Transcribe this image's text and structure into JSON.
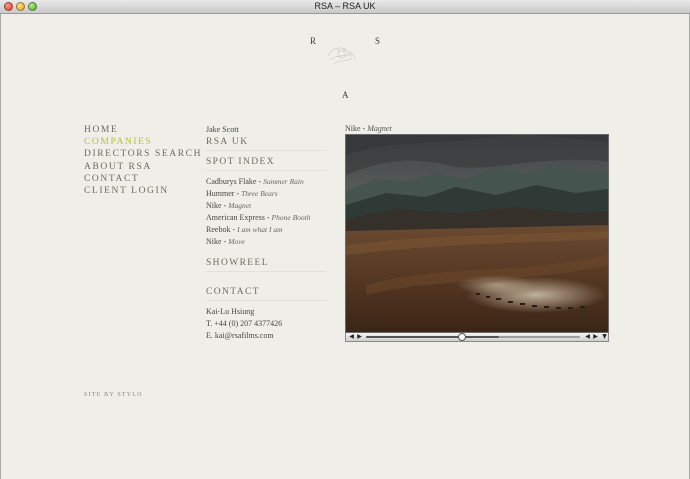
{
  "window": {
    "title": "RSA – RSA UK"
  },
  "logo": {
    "letters": [
      "R",
      "S",
      "A"
    ]
  },
  "nav": {
    "items": [
      {
        "label": "HOME",
        "active": false
      },
      {
        "label": "COMPANIES",
        "active": true
      },
      {
        "label": "DIRECTORS SEARCH",
        "active": false
      },
      {
        "label": "ABOUT RSA",
        "active": false
      },
      {
        "label": "CONTACT",
        "active": false
      },
      {
        "label": "CLIENT LOGIN",
        "active": false
      }
    ]
  },
  "credit": "SITE BY STYLO",
  "company": {
    "founder": "Jake Scott",
    "name": "RSA UK"
  },
  "spot_index": {
    "heading": "SPOT INDEX",
    "spots": [
      {
        "client": "Cadburys Flake",
        "title": "Summer Rain"
      },
      {
        "client": "Hummer",
        "title": "Three Bears"
      },
      {
        "client": "Nike",
        "title": "Magnet"
      },
      {
        "client": "American Express",
        "title": "Phone Booth"
      },
      {
        "client": "Reebok",
        "title": "I am what I am"
      },
      {
        "client": "Nike",
        "title": "Move"
      }
    ]
  },
  "showreel": {
    "label": "SHOWREEL"
  },
  "contact": {
    "heading": "CONTACT",
    "name": "Kai-Lu Hsiung",
    "phone": "T. +44 (0) 207 4377426",
    "email": "E. kai@rsafilms.com"
  },
  "video": {
    "client": "Nike",
    "title": "Magnet",
    "progress": 0.45,
    "buffered": 0.62
  },
  "colors": {
    "accent": "#b7c23b",
    "background": "#efeee9",
    "text": "#5e5a52"
  }
}
